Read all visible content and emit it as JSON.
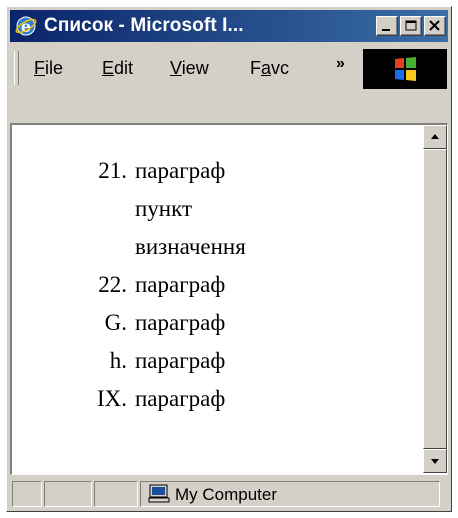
{
  "window": {
    "title": "Список - Microsoft I...",
    "icon": "ie-icon",
    "controls": [
      "minimize-icon",
      "maximize-icon",
      "close-icon"
    ]
  },
  "menubar": {
    "items": [
      {
        "label": "File",
        "accel": "F",
        "rest": "ile"
      },
      {
        "label": "Edit",
        "accel": "E",
        "rest": "dit"
      },
      {
        "label": "View",
        "accel": "V",
        "rest": "iew"
      },
      {
        "label": "Favc",
        "pre": "F",
        "accel": "a",
        "rest": "vc"
      }
    ],
    "overflow": "»",
    "logo": "windows-logo-icon"
  },
  "content": {
    "list": [
      {
        "marker": "21.",
        "lines": [
          "параграф",
          "пункт",
          "визначення"
        ]
      },
      {
        "marker": "22.",
        "lines": [
          "параграф"
        ]
      },
      {
        "marker": "G.",
        "lines": [
          "параграф"
        ]
      },
      {
        "marker": "h.",
        "lines": [
          "параграф"
        ]
      },
      {
        "marker": "IX.",
        "lines": [
          "параграф"
        ]
      }
    ]
  },
  "status": {
    "zone": "My Computer",
    "zone_icon": "computer-icon"
  },
  "colors": {
    "titlebar_start": "#0a246a",
    "titlebar_end": "#3a6ea5",
    "chrome": "#d4d0c8"
  }
}
